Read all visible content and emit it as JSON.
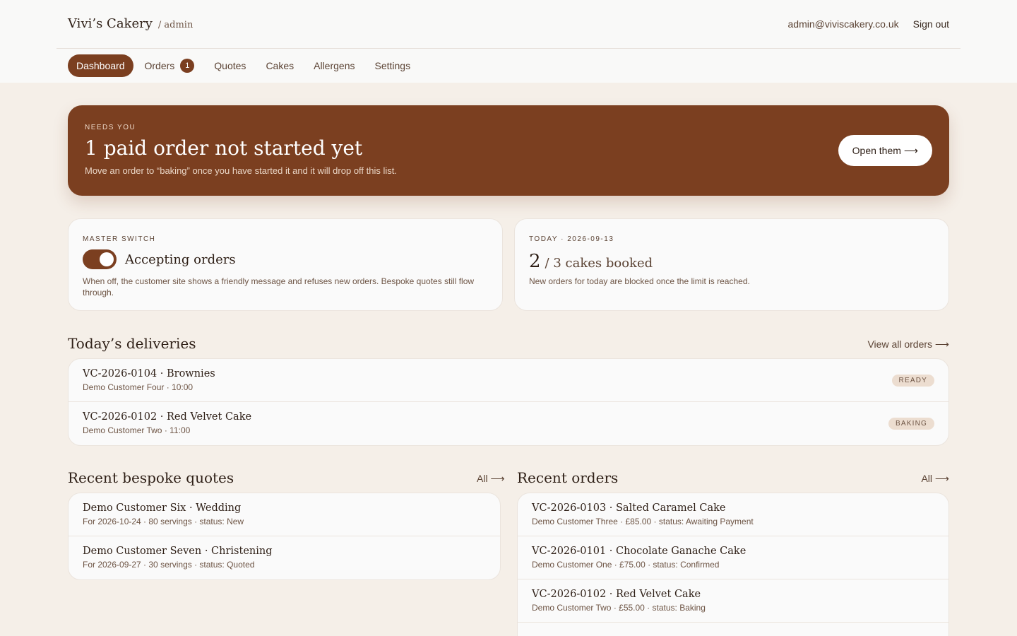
{
  "header": {
    "brand": "Vivi’s Cakery",
    "brand_suffix": "/ admin",
    "email": "admin@viviscakery.co.uk",
    "signout": "Sign out"
  },
  "nav": {
    "dashboard": "Dashboard",
    "orders": "Orders",
    "orders_badge": "1",
    "quotes": "Quotes",
    "cakes": "Cakes",
    "allergens": "Allergens",
    "settings": "Settings"
  },
  "hero": {
    "kicker": "NEEDS YOU",
    "title": "1 paid order not started yet",
    "description": "Move an order to “baking” once you have started it and it will drop off this list.",
    "button": "Open them",
    "button_icon": "arrow-right-icon"
  },
  "master_switch": {
    "kicker": "MASTER SWITCH",
    "label": "Accepting orders",
    "enabled": true,
    "description": "When off, the customer site shows a friendly message and refuses new orders. Bespoke quotes still flow through."
  },
  "today": {
    "kicker": "TODAY · 2026-09-13",
    "booked": "2",
    "limit_text": "/ 3 cakes booked",
    "description": "New orders for today are blocked once the limit is reached."
  },
  "deliveries": {
    "title": "Today’s deliveries",
    "link": "View all orders",
    "items": [
      {
        "title": "VC-2026-0104 · Brownies",
        "sub": "Demo Customer Four · 10:00",
        "status": "READY"
      },
      {
        "title": "VC-2026-0102 · Red Velvet Cake",
        "sub": "Demo Customer Two · 11:00",
        "status": "BAKING"
      }
    ]
  },
  "quotes": {
    "title": "Recent bespoke quotes",
    "link": "All",
    "items": [
      {
        "title": "Demo Customer Six · Wedding",
        "sub": "For 2026-10-24 · 80 servings · status: New"
      },
      {
        "title": "Demo Customer Seven · Christening",
        "sub": "For 2026-09-27 · 30 servings · status: Quoted"
      }
    ]
  },
  "orders": {
    "title": "Recent orders",
    "link": "All",
    "items": [
      {
        "title": "VC-2026-0103 · Salted Caramel Cake",
        "sub": "Demo Customer Three · £85.00 · status: Awaiting Payment"
      },
      {
        "title": "VC-2026-0101 · Chocolate Ganache Cake",
        "sub": "Demo Customer One · £75.00 · status: Confirmed"
      },
      {
        "title": "VC-2026-0102 · Red Velvet Cake",
        "sub": "Demo Customer Two · £55.00 · status: Baking"
      }
    ]
  },
  "colors": {
    "brand": "#7b3f20",
    "background": "#f5efe8",
    "card": "#fafafa"
  }
}
